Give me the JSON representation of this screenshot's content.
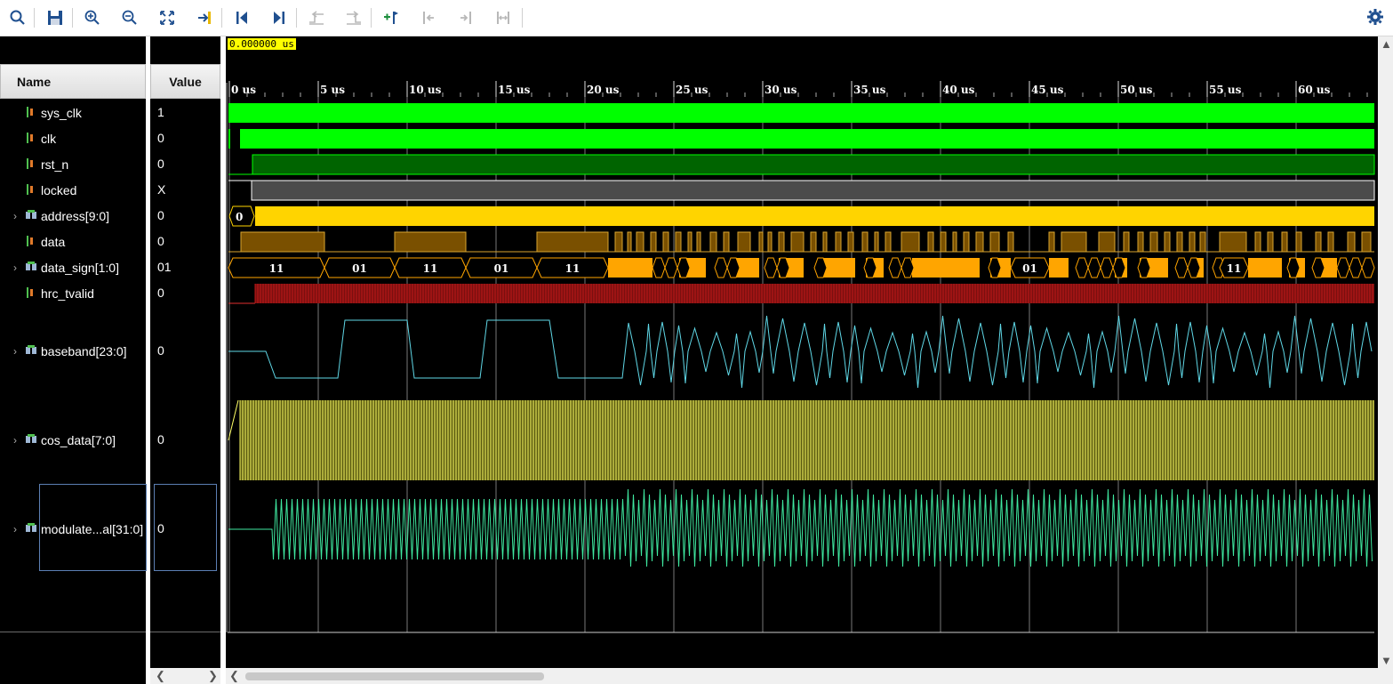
{
  "toolbar": {
    "buttons": [
      "search-icon",
      "save-icon",
      "zoom-in-icon",
      "zoom-out-icon",
      "zoom-fit-icon",
      "go-to-cursor-icon",
      "go-to-start-icon",
      "go-to-end-icon",
      "previous-transition-icon",
      "next-transition-icon",
      "add-marker-icon",
      "previous-marker-icon",
      "next-marker-icon",
      "swap-cursors-icon",
      "settings-icon"
    ]
  },
  "headers": {
    "name": "Name",
    "value": "Value"
  },
  "cursor_time": "0.000000 us",
  "time_ticks": [
    "0 us",
    "5 us",
    "10 us",
    "15 us",
    "20 us",
    "25 us",
    "30 us",
    "35 us",
    "40 us",
    "45 us",
    "50 us",
    "55 us",
    "60 us"
  ],
  "signals": [
    {
      "name": "sys_clk",
      "value": "1",
      "expandable": false,
      "bus": false
    },
    {
      "name": "clk",
      "value": "0",
      "expandable": false,
      "bus": false
    },
    {
      "name": "rst_n",
      "value": "0",
      "expandable": false,
      "bus": false
    },
    {
      "name": "locked",
      "value": "X",
      "expandable": false,
      "bus": false
    },
    {
      "name": "address[9:0]",
      "value": "0",
      "expandable": true,
      "bus": true
    },
    {
      "name": "data",
      "value": "0",
      "expandable": false,
      "bus": false
    },
    {
      "name": "data_sign[1:0]",
      "value": "01",
      "expandable": true,
      "bus": true
    },
    {
      "name": "hrc_tvalid",
      "value": "0",
      "expandable": false,
      "bus": false
    },
    {
      "name": "baseband[23:0]",
      "value": "0",
      "expandable": true,
      "bus": true
    },
    {
      "name": "cos_data[7:0]",
      "value": "0",
      "expandable": true,
      "bus": true
    },
    {
      "name": "modulate...al[31:0]",
      "value": "0",
      "expandable": true,
      "bus": true
    }
  ],
  "address_label": "0",
  "data_sign_labels": [
    "11",
    "01",
    "11",
    "01",
    "11",
    "01",
    "11"
  ],
  "colors": {
    "clock_green": "#00ff00",
    "rst_green": "#006400",
    "locked_gray": "#4b4b4b",
    "bus_yellow": "#ffd400",
    "data_brown": "#7a5000",
    "data_sign_orange": "#ffa500",
    "tvalid_red": "#c01818",
    "baseband_cyan": "#5fd7e6",
    "cos_yellow": "#ffff66",
    "modulate_green": "#3fe8a0"
  }
}
